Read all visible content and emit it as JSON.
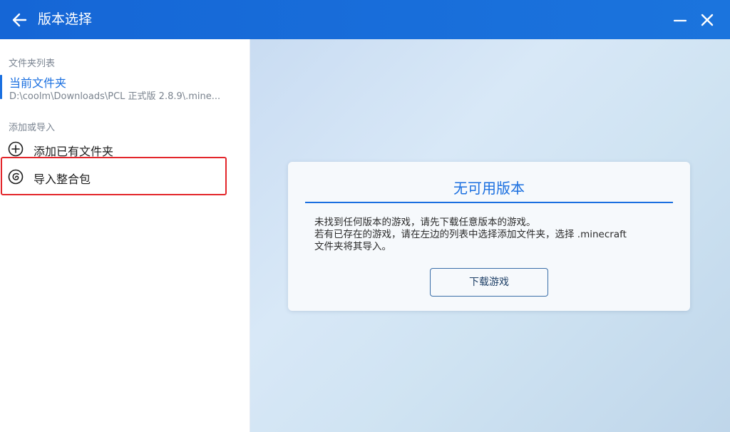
{
  "window": {
    "title": "版本选择"
  },
  "sidebar": {
    "folder_list_label": "文件夹列表",
    "current_folder": {
      "name": "当前文件夹",
      "path": "D:\\coolm\\Downloads\\PCL 正式版 2.8.9\\.mine..."
    },
    "add_import_label": "添加或导入",
    "items": [
      {
        "label": "添加已有文件夹",
        "icon": "add-circle-icon"
      },
      {
        "label": "导入整合包",
        "icon": "modpack-import-icon"
      }
    ]
  },
  "main": {
    "card": {
      "title": "无可用版本",
      "lines": [
        "未找到任何版本的游戏，请先下载任意版本的游戏。",
        "若有已存在的游戏，请在左边的列表中选择添加文件夹，选择 .minecraft",
        "文件夹将其导入。"
      ],
      "button_label": "下载游戏"
    }
  },
  "colors": {
    "accent": "#1a6fe0",
    "titlebar": "#1566d6",
    "highlight": "#e3262b"
  }
}
